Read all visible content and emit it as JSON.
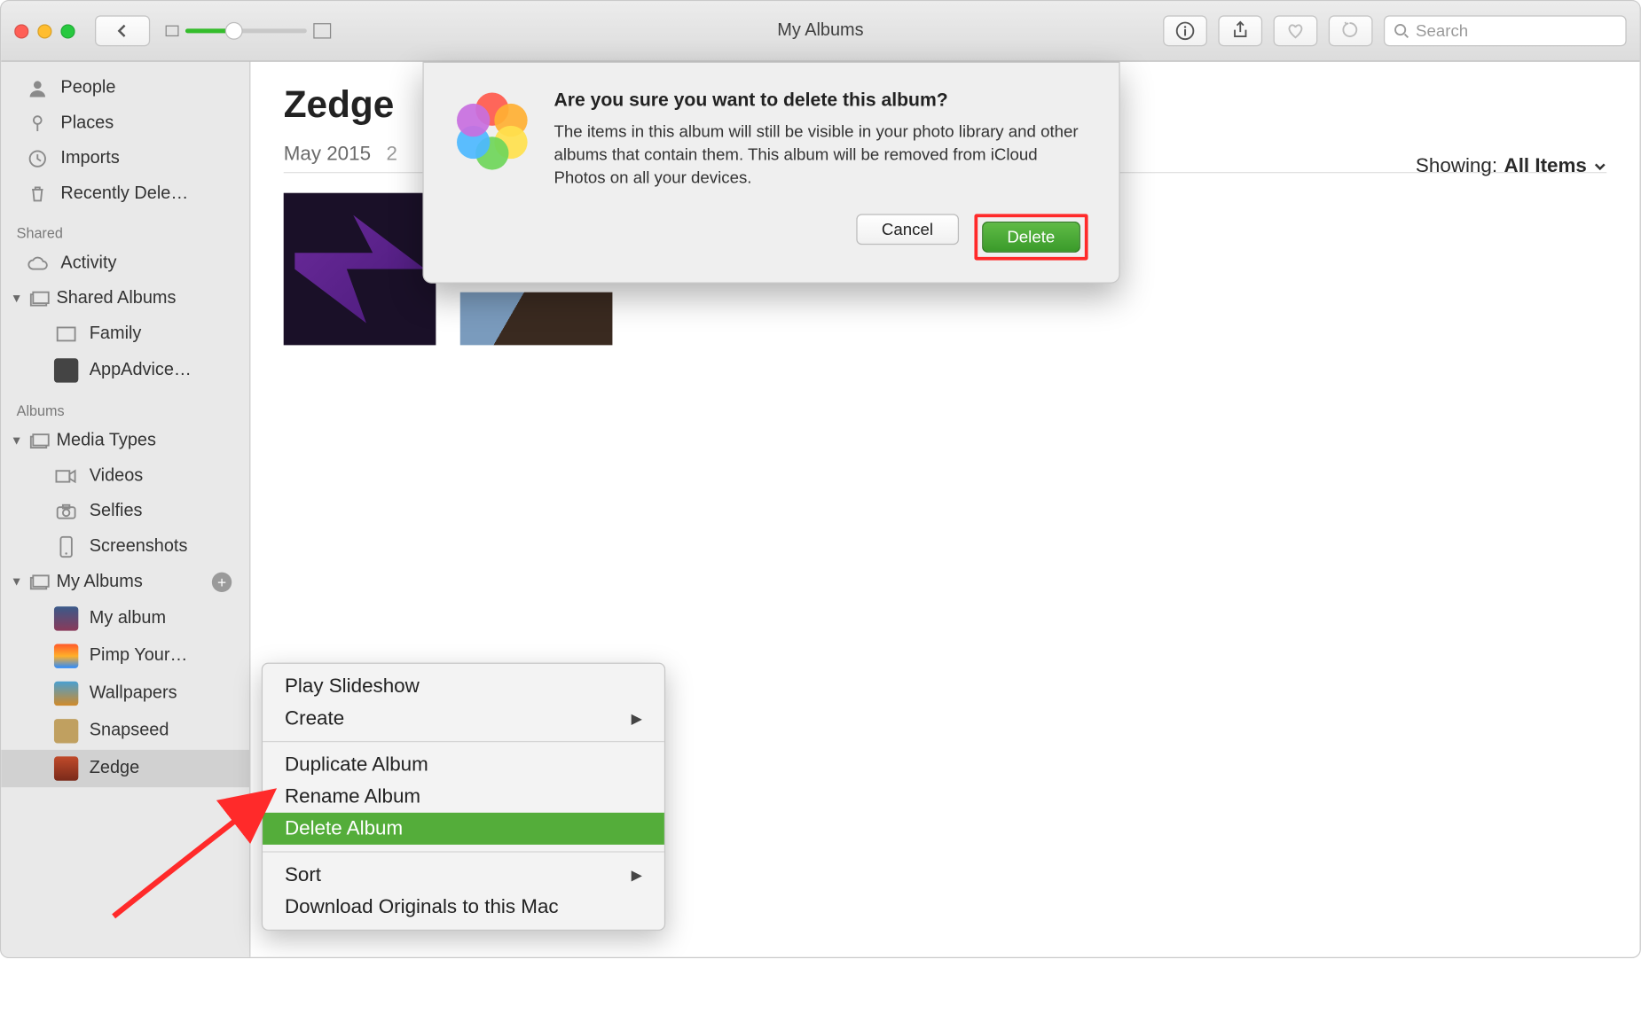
{
  "window": {
    "title": "My Albums"
  },
  "toolbar": {
    "search_placeholder": "Search"
  },
  "sidebar": {
    "top_items": [
      {
        "label": "People",
        "icon": "person"
      },
      {
        "label": "Places",
        "icon": "pin"
      },
      {
        "label": "Imports",
        "icon": "clock"
      },
      {
        "label": "Recently Dele…",
        "icon": "trash"
      }
    ],
    "shared_header": "Shared",
    "shared_items": [
      {
        "label": "Activity",
        "icon": "cloud"
      }
    ],
    "shared_albums_label": "Shared Albums",
    "shared_albums_children": [
      {
        "label": "Family"
      },
      {
        "label": "AppAdvice…"
      }
    ],
    "albums_header": "Albums",
    "media_types_label": "Media Types",
    "media_types_children": [
      {
        "label": "Videos"
      },
      {
        "label": "Selfies"
      },
      {
        "label": "Screenshots"
      }
    ],
    "my_albums_label": "My Albums",
    "my_albums_children": [
      {
        "label": "My album"
      },
      {
        "label": "Pimp Your…"
      },
      {
        "label": "Wallpapers"
      },
      {
        "label": "Snapseed"
      },
      {
        "label": "Zedge",
        "selected": true
      }
    ]
  },
  "content": {
    "album_title": "Zedge",
    "date_label": "May 2015",
    "count_label": "2",
    "showing_label": "Showing:",
    "showing_value": "All Items"
  },
  "context_menu": {
    "items": [
      {
        "label": "Play Slideshow"
      },
      {
        "label": "Create",
        "submenu": true
      },
      {
        "separator": true
      },
      {
        "label": "Duplicate Album"
      },
      {
        "label": "Rename Album"
      },
      {
        "label": "Delete Album",
        "selected": true
      },
      {
        "separator": true
      },
      {
        "label": "Sort",
        "submenu": true
      },
      {
        "label": "Download Originals to this Mac"
      }
    ]
  },
  "dialog": {
    "title": "Are you sure you want to delete this album?",
    "message": "The items in this album will still be visible in your photo library and other albums that contain them. This album will be removed from iCloud Photos on all your devices.",
    "cancel_label": "Cancel",
    "confirm_label": "Delete"
  }
}
